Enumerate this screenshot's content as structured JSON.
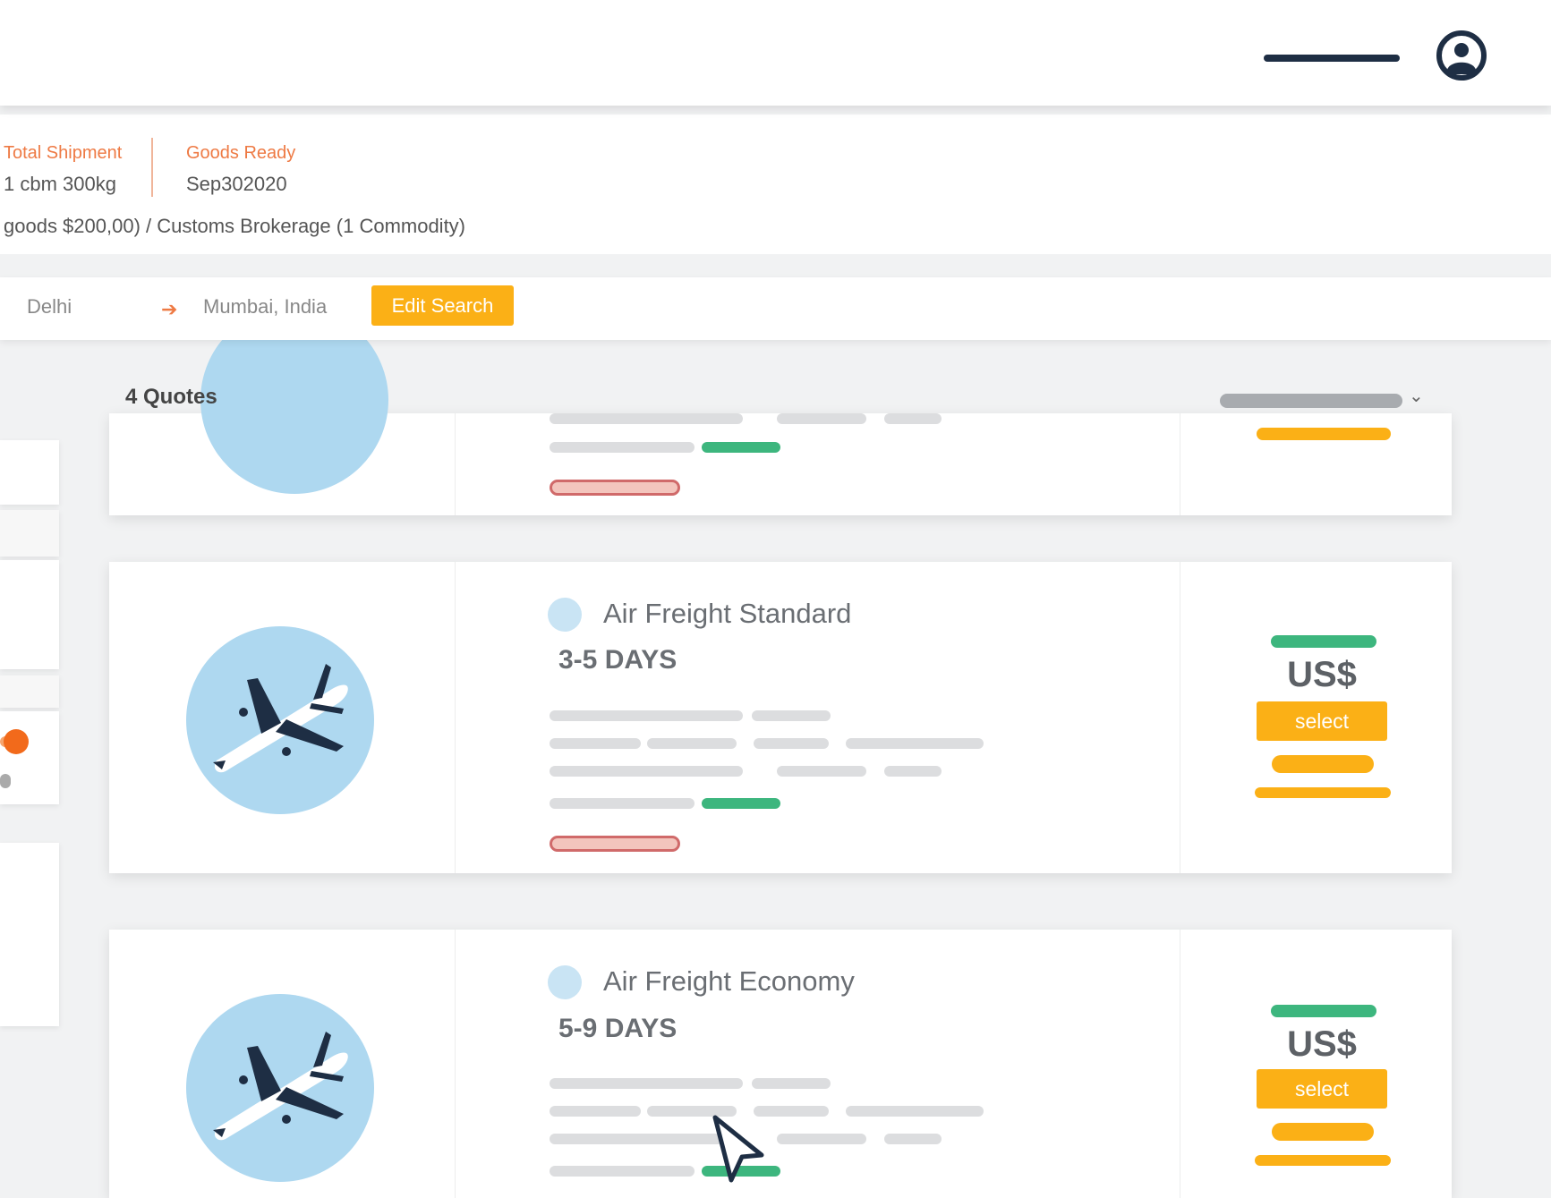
{
  "header": {
    "menu_icon": "menu-line-icon",
    "user_icon": "user-account-icon"
  },
  "summary": {
    "total_shipment_label": "Total Shipment",
    "total_shipment_value": "1 cbm 300kg",
    "goods_ready_label": "Goods Ready",
    "goods_ready_value": "Sep302020",
    "services": "goods $200,00) / Customs Brokerage (1 Commodity)"
  },
  "search": {
    "origin": "Delhi",
    "destination": "Mumbai, India",
    "edit_label": "Edit Search"
  },
  "results": {
    "count_label": "4 Quotes"
  },
  "quotes": [
    {
      "service": "Air Freight Standard",
      "transit": "3-5 DAYS",
      "currency": "US$",
      "select_label": "select"
    },
    {
      "service": "Air Freight Economy",
      "transit": "5-9 DAYS",
      "currency": "US$",
      "select_label": "select"
    }
  ],
  "colors": {
    "accent": "#fbb016",
    "orange": "#ee7a44",
    "navy": "#1e2e44",
    "green": "#3db67e",
    "plane_bg": "#aed8f0"
  }
}
